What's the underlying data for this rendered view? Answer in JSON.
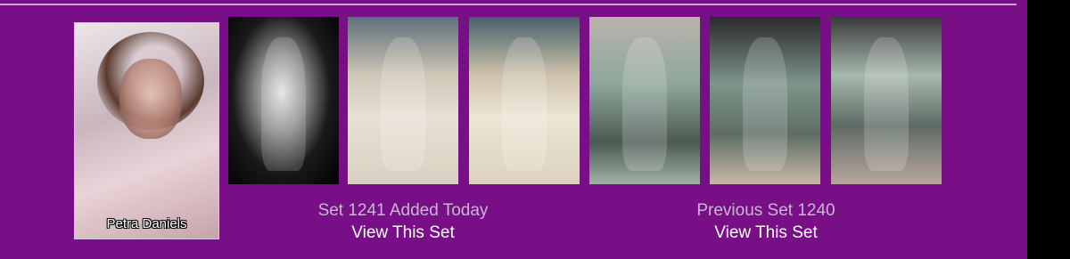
{
  "profile": {
    "name": "Petra Daniels"
  },
  "current_set": {
    "caption": "Set 1241 Added Today",
    "link_label": "View This Set"
  },
  "previous_set": {
    "caption": "Previous Set 1240",
    "link_label": "View This Set"
  },
  "colors": {
    "panel": "#780f87",
    "caption_muted": "#c8b6d2",
    "link": "#ffffff",
    "border": "#000000"
  }
}
